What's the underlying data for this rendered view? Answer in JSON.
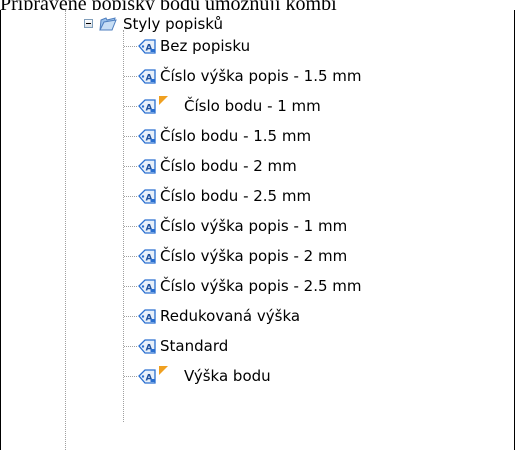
{
  "caption": "Připravené popisky bodů umožňují kombi",
  "tree": {
    "root": {
      "label": "Styly popisků",
      "icon": "folder-icon",
      "expanded": true
    },
    "items": [
      {
        "label": "Bez popisku",
        "flag": false
      },
      {
        "label": "Číslo  výška popis - 1.5 mm",
        "flag": false
      },
      {
        "label": "Číslo bodu - 1 mm",
        "flag": true
      },
      {
        "label": "Číslo bodu - 1.5 mm",
        "flag": false
      },
      {
        "label": "Číslo bodu - 2 mm",
        "flag": false
      },
      {
        "label": "Číslo bodu - 2.5 mm",
        "flag": false
      },
      {
        "label": "Číslo výška popis - 1 mm",
        "flag": false
      },
      {
        "label": "Číslo výška popis - 2 mm",
        "flag": false
      },
      {
        "label": "Číslo výška popis - 2.5 mm",
        "flag": false
      },
      {
        "label": "Redukovaná výška",
        "flag": false
      },
      {
        "label": "Standard",
        "flag": false
      },
      {
        "label": "Výška bodu",
        "flag": true
      }
    ]
  },
  "colors": {
    "folder": "#6fa0d8",
    "style_icon_blue": "#2a6fd0",
    "flag": "#f0a020"
  }
}
